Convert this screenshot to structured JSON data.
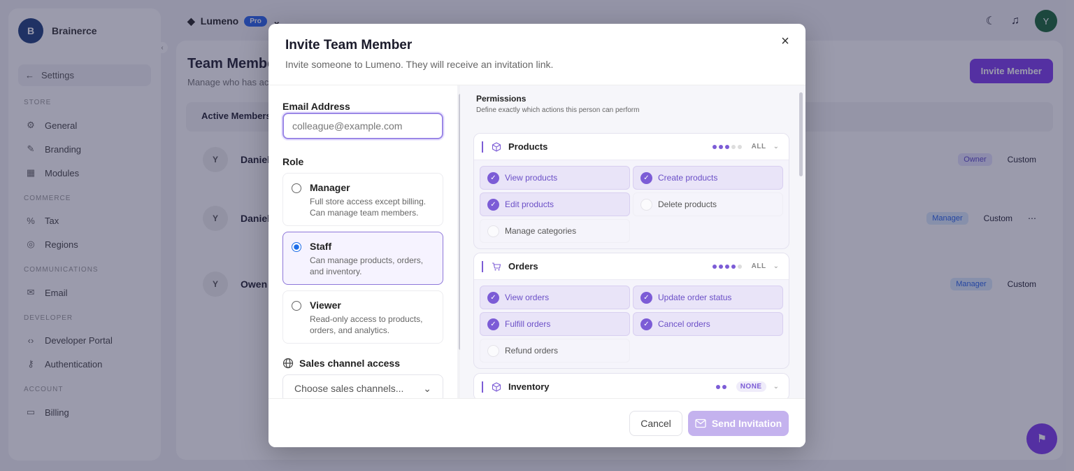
{
  "app": {
    "brand": "Brainerce",
    "back_label": "Settings",
    "sections": [
      {
        "label": "STORE",
        "items": [
          "General",
          "Branding",
          "Modules"
        ]
      },
      {
        "label": "COMMERCE",
        "items": [
          "Tax",
          "Regions"
        ]
      },
      {
        "label": "COMMUNICATIONS",
        "items": [
          "Email"
        ]
      },
      {
        "label": "DEVELOPER",
        "items": [
          "Developer Portal",
          "Authentication"
        ]
      },
      {
        "label": "ACCOUNT",
        "items": [
          "Billing"
        ]
      }
    ],
    "workspace": "Lumeno",
    "plan_badge": "Pro",
    "avatar_initial": "Y",
    "page_title": "Team Members",
    "page_subtitle": "Manage who has access",
    "invite_button": "Invite Member",
    "tab_active": "Active Members",
    "members": [
      {
        "initial": "Y",
        "name": "Daniel",
        "role": "Owner",
        "perm": "Custom"
      },
      {
        "initial": "Y",
        "name": "Daniel",
        "role": "Manager",
        "perm": "Custom"
      },
      {
        "initial": "Y",
        "name": "Owen",
        "role": "Manager",
        "perm": "Custom"
      }
    ]
  },
  "modal": {
    "title": "Invite Team Member",
    "subtitle": "Invite someone to Lumeno. They will receive an invitation link.",
    "close_icon": "×",
    "email_label": "Email Address",
    "email_placeholder": "colleague@example.com",
    "role_label": "Role",
    "roles": [
      {
        "name": "Manager",
        "desc": "Full store access except billing. Can manage team members.",
        "selected": false
      },
      {
        "name": "Staff",
        "desc": "Can manage products, orders, and inventory.",
        "selected": true
      },
      {
        "name": "Viewer",
        "desc": "Read-only access to products, orders, and analytics.",
        "selected": false
      }
    ],
    "sales_channel_label": "Sales channel access",
    "sales_channel_placeholder": "Choose sales channels...",
    "permissions_title": "Permissions",
    "permissions_subtitle": "Define exactly which actions this person can perform",
    "groups": [
      {
        "name": "Products",
        "status": "ALL",
        "dots_on": 3,
        "dots_total": 5,
        "perms": [
          {
            "label": "View products",
            "on": true
          },
          {
            "label": "Create products",
            "on": true
          },
          {
            "label": "Edit products",
            "on": true
          },
          {
            "label": "Delete products",
            "on": false
          },
          {
            "label": "Manage categories",
            "on": false
          }
        ]
      },
      {
        "name": "Orders",
        "status": "ALL",
        "dots_on": 4,
        "dots_total": 5,
        "perms": [
          {
            "label": "View orders",
            "on": true
          },
          {
            "label": "Update order status",
            "on": true
          },
          {
            "label": "Fulfill orders",
            "on": true
          },
          {
            "label": "Cancel orders",
            "on": true
          },
          {
            "label": "Refund orders",
            "on": false
          }
        ]
      },
      {
        "name": "Inventory",
        "status": "NONE",
        "dots_on": 2,
        "dots_total": 2,
        "perms": []
      }
    ],
    "cancel_button": "Cancel",
    "send_button": "Send Invitation"
  },
  "colors": {
    "accent": "#7c5cd6",
    "overlay": "#26264a",
    "send_disabled": "#c4b2ee"
  }
}
